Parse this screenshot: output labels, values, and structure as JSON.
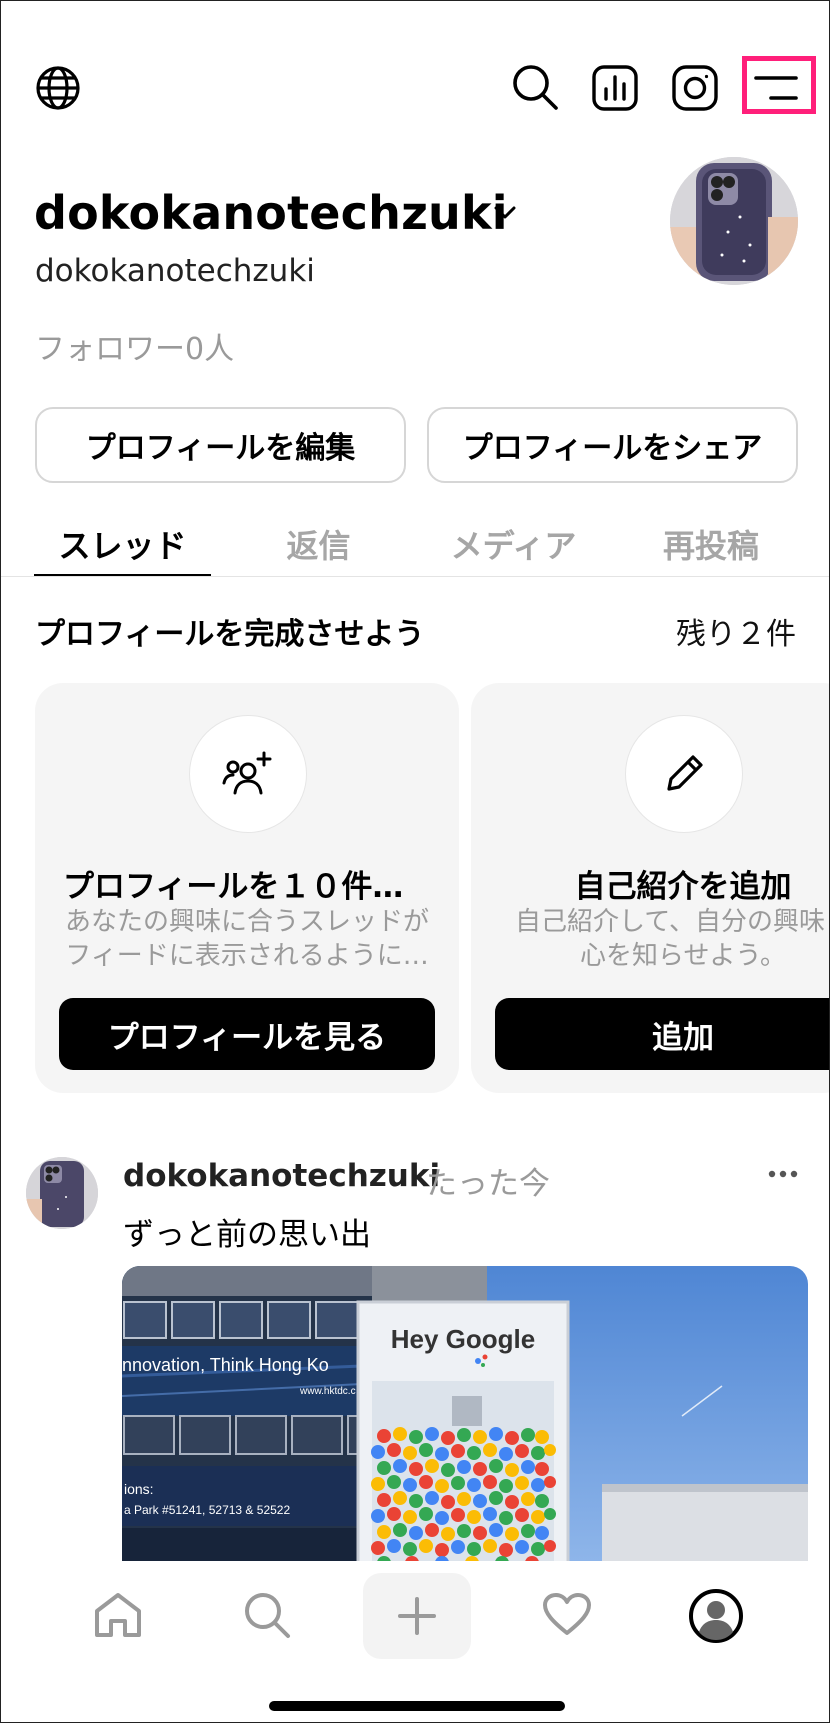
{
  "header": {
    "icons": [
      "globe-icon",
      "search-icon",
      "insights-icon",
      "instagram-icon",
      "menu-icon"
    ]
  },
  "profile": {
    "display_name": "dokokanotechzuki",
    "username": "dokokanotechzuki",
    "followers": "フォロワー0人",
    "edit_button": "プロフィールを編集",
    "share_button": "プロフィールをシェア"
  },
  "tabs": [
    {
      "label": "スレッド",
      "active": true
    },
    {
      "label": "返信",
      "active": false
    },
    {
      "label": "メディア",
      "active": false
    },
    {
      "label": "再投稿",
      "active": false
    }
  ],
  "complete_profile": {
    "title": "プロフィールを完成させよう",
    "remaining": "残り２件",
    "cards": [
      {
        "icon": "add-people-icon",
        "title": "プロフィールを１０件フ…",
        "description": "あなたの興味に合うスレッドが\nフィードに表示されるように…",
        "button": "プロフィールを見る"
      },
      {
        "icon": "pencil-icon",
        "title": "自己紹介を追加",
        "description": "自己紹介して、自分の興味・\n心を知らせよう。",
        "button": "追加"
      }
    ]
  },
  "post": {
    "username": "dokokanotechzuki",
    "time": "たった今",
    "text": "ずっと前の思い出",
    "image_text": {
      "banner": "nnovation, Think Hong Ko",
      "url": "www.hktdc.c",
      "small": "ions:",
      "address": "a Park #51241, 52713 & 52522",
      "sign": "Hey Google"
    }
  },
  "bottom_nav": {
    "items": [
      "home-icon",
      "search-icon",
      "plus-icon",
      "heart-icon",
      "profile-icon"
    ],
    "plus_label": "+"
  }
}
